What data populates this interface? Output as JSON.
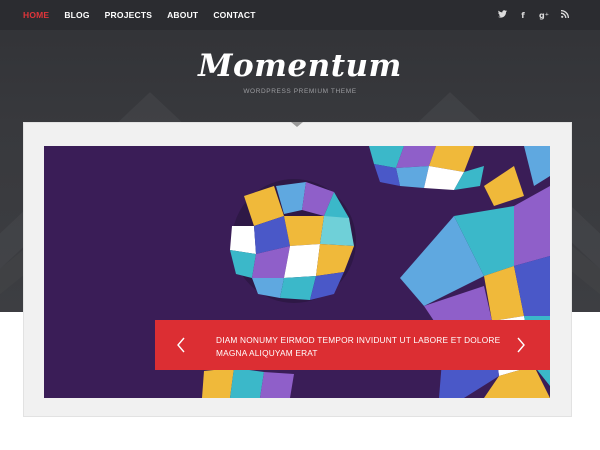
{
  "nav": {
    "items": [
      {
        "label": "HOME",
        "active": true
      },
      {
        "label": "BLOG",
        "active": false
      },
      {
        "label": "PROJECTS",
        "active": false
      },
      {
        "label": "ABOUT",
        "active": false
      },
      {
        "label": "CONTACT",
        "active": false
      }
    ],
    "active_color": "#e0353a"
  },
  "social": [
    {
      "name": "twitter-icon",
      "glyph": "🐦"
    },
    {
      "name": "facebook-icon",
      "glyph": "f"
    },
    {
      "name": "google-plus-icon",
      "glyph": "g⁺"
    },
    {
      "name": "rss-icon",
      "glyph": "◉"
    }
  ],
  "header": {
    "logo": "Momentum",
    "tagline": "WORDPRESS PREMIUM THEME"
  },
  "slider": {
    "caption_line1": "DIAM NONUMY EIRMOD TEMPOR INVIDUNT UT LABORE ET DOLORE",
    "caption_line2": "MAGNA ALIQUYAM ERAT",
    "prev_icon": "chevron-left-icon",
    "next_icon": "chevron-right-icon",
    "caption_bg": "#dc2e33"
  },
  "colors": {
    "header_bg": "#2b2c30",
    "hero_bg": "#38393d",
    "slide_bg": "#3a1d57"
  }
}
